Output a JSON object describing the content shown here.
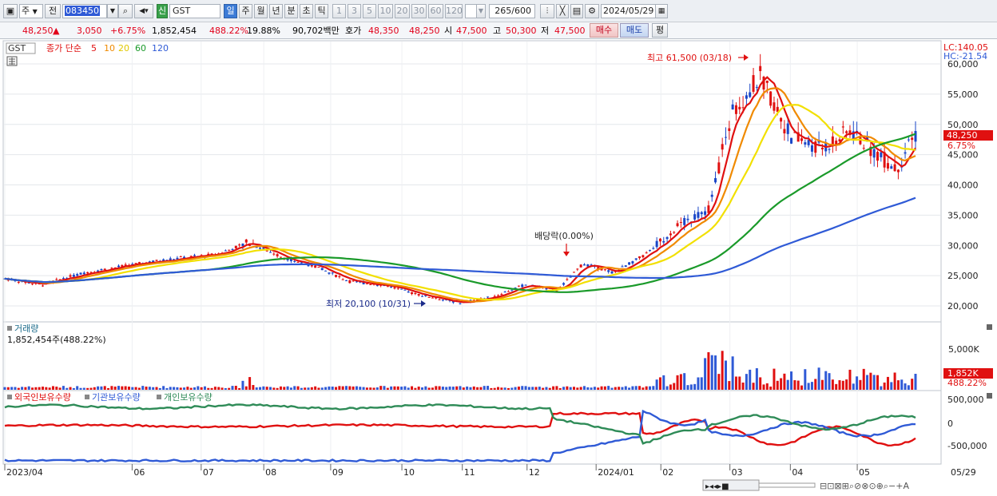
{
  "toolbar": {
    "market": "주",
    "prev_label": "전",
    "stock_code": "083450",
    "sin_badge": "신",
    "stock_name": "GST",
    "periods": [
      "일",
      "주",
      "월",
      "년",
      "분",
      "초",
      "틱"
    ],
    "active_period": "일",
    "intervals": [
      "1",
      "3",
      "5",
      "10",
      "20",
      "30",
      "60",
      "120"
    ],
    "count": "265",
    "count_total": "/600",
    "date": "2024/05/29"
  },
  "quote": {
    "price": "48,250",
    "change": "3,050",
    "change_pct": "+6.75%",
    "volume": "1,852,454",
    "volume_ratio": "488.22%",
    "turnover": "19.88%",
    "amount": "90,702백만",
    "bid_label": "호가",
    "bid1": "48,350",
    "bid2": "48,250",
    "open_label": "시",
    "open": "47,500",
    "high_label": "고",
    "high": "50,300",
    "low_label": "저",
    "low": "47,500",
    "buy_button": "매수",
    "sell_button": "매도",
    "eval_button": "평"
  },
  "price_panel": {
    "tag": "GST",
    "ma_title": "종가 단순",
    "ma_periods": [
      "5",
      "10",
      "20",
      "60",
      "120"
    ],
    "ma_colors": [
      "#e01010",
      "#f08a00",
      "#f2e000",
      "#1a9a2a",
      "#2f5ad6"
    ],
    "lc_label": "LC:140.05",
    "hc_label": "HC:-21.54",
    "last_price_label": "48,250",
    "last_pct_label": "6.75%",
    "high_annotation": "최고 61,500 (03/18)",
    "low_annotation": "최저 20,100 (10/31)",
    "dividend_annotation": "배당락(0.00%)",
    "y_ticks": [
      "60,000",
      "55,000",
      "50,000",
      "45,000",
      "40,000",
      "35,000",
      "30,000",
      "25,000",
      "20,000"
    ]
  },
  "volume_panel": {
    "title": "거래량",
    "value_label": "1,852,454주(488.22%)",
    "y_tick": "5,000K",
    "last_label": "1,852K",
    "last_pct": "488.22%"
  },
  "holdings_panel": {
    "titles": [
      "외국인보유수량",
      "기관보유수량",
      "개인보유수량"
    ],
    "colors": [
      "#e01010",
      "#2f5ad6",
      "#2e8b57"
    ],
    "y_ticks": [
      "500,000",
      "0",
      "-500,000"
    ]
  },
  "x_axis": [
    "2023/04",
    "06",
    "07",
    "08",
    "09",
    "10",
    "11",
    "12",
    "2024/01",
    "02",
    "03",
    "04",
    "05",
    "05/29"
  ],
  "chart_data": {
    "type": "candlestick",
    "title": "GST",
    "y_range": [
      18000,
      62000
    ],
    "annotations": [
      {
        "text": "최고 61,500 (03/18)",
        "x": "2024/03/18",
        "y": 61500
      },
      {
        "text": "최저 20,100 (10/31)",
        "x": "2023/10/31",
        "y": 20100
      },
      {
        "text": "배당락(0.00%)",
        "x": "2023/12/27"
      }
    ],
    "moving_averages": [
      {
        "name": "5",
        "color": "#e01010"
      },
      {
        "name": "10",
        "color": "#f08a00"
      },
      {
        "name": "20",
        "color": "#f2e000"
      },
      {
        "name": "60",
        "color": "#1a9a2a"
      },
      {
        "name": "120",
        "color": "#2f5ad6"
      }
    ],
    "close_path_points": [
      [
        "2023/04/03",
        24500
      ],
      [
        "2023/04/20",
        23500
      ],
      [
        "2023/05/10",
        25500
      ],
      [
        "2023/06/01",
        26800
      ],
      [
        "2023/06/20",
        27800
      ],
      [
        "2023/07/10",
        28500
      ],
      [
        "2023/07/25",
        30500
      ],
      [
        "2023/08/10",
        28000
      ],
      [
        "2023/08/25",
        26500
      ],
      [
        "2023/09/10",
        24000
      ],
      [
        "2023/09/25",
        23500
      ],
      [
        "2023/10/10",
        22000
      ],
      [
        "2023/10/31",
        20500
      ],
      [
        "2023/11/15",
        21500
      ],
      [
        "2023/11/30",
        23500
      ],
      [
        "2023/12/15",
        22500
      ],
      [
        "2023/12/27",
        27000
      ],
      [
        "2024/01/10",
        25500
      ],
      [
        "2024/01/25",
        28500
      ],
      [
        "2024/02/08",
        33000
      ],
      [
        "2024/02/23",
        36000
      ],
      [
        "2024/03/05",
        52000
      ],
      [
        "2024/03/18",
        58000
      ],
      [
        "2024/04/01",
        48000
      ],
      [
        "2024/04/15",
        46000
      ],
      [
        "2024/04/29",
        49000
      ],
      [
        "2024/05/10",
        45500
      ],
      [
        "2024/05/20",
        42500
      ],
      [
        "2024/05/29",
        48250
      ]
    ]
  }
}
